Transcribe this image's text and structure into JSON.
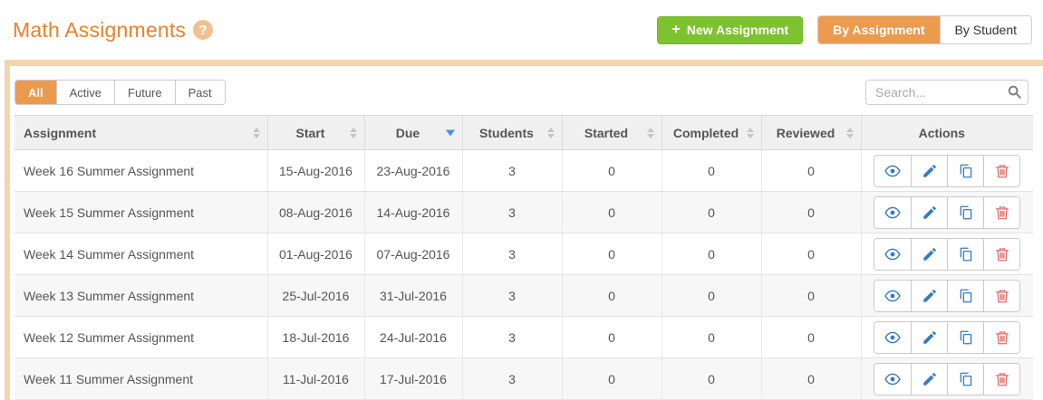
{
  "header": {
    "title": "Math Assignments",
    "help_glyph": "?",
    "new_assignment": {
      "icon_glyph": "+",
      "label": "New Assignment"
    },
    "view_toggle": [
      {
        "label": "By Assignment",
        "active": true
      },
      {
        "label": "By Student",
        "active": false
      }
    ]
  },
  "filters": [
    {
      "label": "All",
      "active": true
    },
    {
      "label": "Active",
      "active": false
    },
    {
      "label": "Future",
      "active": false
    },
    {
      "label": "Past",
      "active": false
    }
  ],
  "search": {
    "placeholder": "Search..."
  },
  "table": {
    "columns": [
      {
        "label": "Assignment",
        "sortable": true,
        "sort": "none",
        "align": "left"
      },
      {
        "label": "Start",
        "sortable": true,
        "sort": "none"
      },
      {
        "label": "Due",
        "sortable": true,
        "sort": "desc"
      },
      {
        "label": "Students",
        "sortable": true,
        "sort": "none"
      },
      {
        "label": "Started",
        "sortable": true,
        "sort": "none"
      },
      {
        "label": "Completed",
        "sortable": true,
        "sort": "none"
      },
      {
        "label": "Reviewed",
        "sortable": true,
        "sort": "none"
      },
      {
        "label": "Actions",
        "sortable": false
      }
    ],
    "rows": [
      {
        "assignment": "Week 16 Summer Assignment",
        "start": "15-Aug-2016",
        "due": "23-Aug-2016",
        "students": "3",
        "started": "0",
        "completed": "0",
        "reviewed": "0"
      },
      {
        "assignment": "Week 15 Summer Assignment",
        "start": "08-Aug-2016",
        "due": "14-Aug-2016",
        "students": "3",
        "started": "0",
        "completed": "0",
        "reviewed": "0"
      },
      {
        "assignment": "Week 14 Summer Assignment",
        "start": "01-Aug-2016",
        "due": "07-Aug-2016",
        "students": "3",
        "started": "0",
        "completed": "0",
        "reviewed": "0"
      },
      {
        "assignment": "Week 13 Summer Assignment",
        "start": "25-Jul-2016",
        "due": "31-Jul-2016",
        "students": "3",
        "started": "0",
        "completed": "0",
        "reviewed": "0"
      },
      {
        "assignment": "Week 12 Summer Assignment",
        "start": "18-Jul-2016",
        "due": "24-Jul-2016",
        "students": "3",
        "started": "0",
        "completed": "0",
        "reviewed": "0"
      },
      {
        "assignment": "Week 11 Summer Assignment",
        "start": "11-Jul-2016",
        "due": "17-Jul-2016",
        "students": "3",
        "started": "0",
        "completed": "0",
        "reviewed": "0"
      }
    ],
    "row_actions": [
      {
        "name": "view",
        "icon": "eye-icon"
      },
      {
        "name": "edit",
        "icon": "pencil-icon"
      },
      {
        "name": "copy",
        "icon": "copy-icon"
      },
      {
        "name": "delete",
        "icon": "trash-icon"
      }
    ]
  },
  "colors": {
    "title_orange": "#e8822a",
    "active_orange": "#ec9a4e",
    "panel_border_peach": "#f3d6ad",
    "new_button_green": "#7dc32f",
    "sort_active_blue": "#4a90e2",
    "action_icon_blue": "#377cc0",
    "action_icon_red": "#e36d6d",
    "header_bg": "#f0f0f0",
    "stripe_bg": "#f7f7f7"
  }
}
